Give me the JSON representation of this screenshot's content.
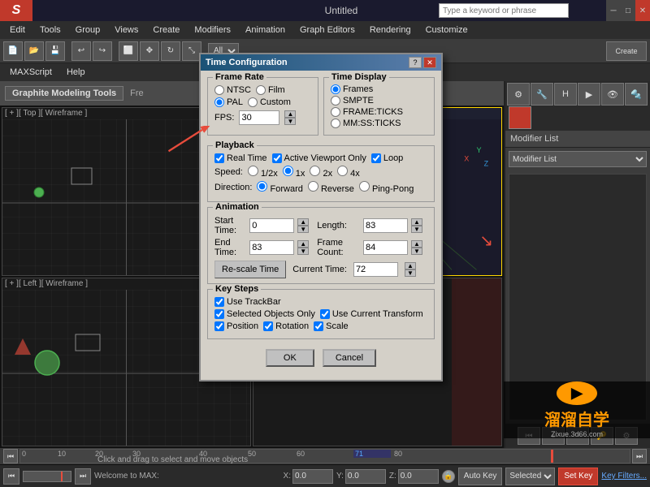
{
  "app": {
    "title": "Untitled",
    "logo": "S",
    "search_placeholder": "Type a keyword or phrase"
  },
  "menubar": {
    "items": [
      "Edit",
      "Tools",
      "Group",
      "Views",
      "Create",
      "Modifiers",
      "Animation",
      "Graph Editors",
      "Rendering",
      "Customize"
    ]
  },
  "menubar2": {
    "items": [
      "MAXScript",
      "Help"
    ]
  },
  "graphite": {
    "label": "Graphite Modeling Tools",
    "second_label": "Fre"
  },
  "toolbar": {
    "all_label": "All"
  },
  "right_panel": {
    "modifier_label": "Modifier List"
  },
  "animation_controls": {
    "buttons": [
      "⏮",
      "◀",
      "▶",
      "⏭",
      "⏹"
    ]
  },
  "timeline": {
    "numbers": [
      "0",
      "10",
      "20",
      "30",
      "40",
      "50",
      "60",
      "71",
      "80"
    ],
    "marker_pos": "87%"
  },
  "status_bar": {
    "welcome": "Welcome to MAX:",
    "drag_text": "Click and drag to select and move objects",
    "x_label": "X:",
    "y_label": "Y:",
    "z_label": "Z:",
    "auto_key": "Auto Key",
    "set_key": "Set Key",
    "selected": "Selected",
    "key_filters": "Key Filters..."
  },
  "dialog": {
    "title": "Time Configuration",
    "frame_rate": {
      "section_title": "Frame Rate",
      "ntsc_label": "NTSC",
      "film_label": "Film",
      "pal_label": "PAL",
      "custom_label": "Custom",
      "fps_label": "FPS:",
      "fps_value": "30"
    },
    "time_display": {
      "section_title": "Time Display",
      "frames_label": "Frames",
      "smpte_label": "SMPTE",
      "frame_ticks_label": "FRAME:TICKS",
      "mm_ss_ticks_label": "MM:SS:TICKS"
    },
    "playback": {
      "section_title": "Playback",
      "real_time_label": "Real Time",
      "active_viewport_label": "Active Viewport Only",
      "loop_label": "Loop",
      "speed_label": "Speed:",
      "speed_half": "1/2x",
      "speed_1x": "1x",
      "speed_2x": "2x",
      "speed_4x": "4x",
      "direction_label": "Direction:",
      "forward_label": "Forward",
      "reverse_label": "Reverse",
      "ping_pong_label": "Ping-Pong"
    },
    "animation": {
      "section_title": "Animation",
      "start_time_label": "Start Time:",
      "start_time_value": "0",
      "length_label": "Length:",
      "length_value": "83",
      "end_time_label": "End Time:",
      "end_time_value": "83",
      "frame_count_label": "Frame Count:",
      "frame_count_value": "84",
      "rescale_label": "Re-scale Time",
      "current_time_label": "Current Time:",
      "current_time_value": "72"
    },
    "key_steps": {
      "section_title": "Key Steps",
      "use_trackbar_label": "Use TrackBar",
      "selected_objects_label": "Selected Objects Only",
      "use_current_transform_label": "Use Current Transform",
      "position_label": "Position",
      "rotation_label": "Rotation",
      "scale_label": "Scale"
    },
    "ok_label": "OK",
    "cancel_label": "Cancel"
  },
  "watermark": {
    "line1": "溜溜自学",
    "line2": "Zixue.3d66.com"
  },
  "viewports": [
    {
      "id": "vp-top-left",
      "label": "[ + ][ Top ][ Wireframe ]"
    },
    {
      "id": "vp-top-right",
      "label": ""
    },
    {
      "id": "vp-bot-left",
      "label": "[ + ][ Left ][ Wireframe ]"
    },
    {
      "id": "vp-bot-right",
      "label": ""
    }
  ]
}
